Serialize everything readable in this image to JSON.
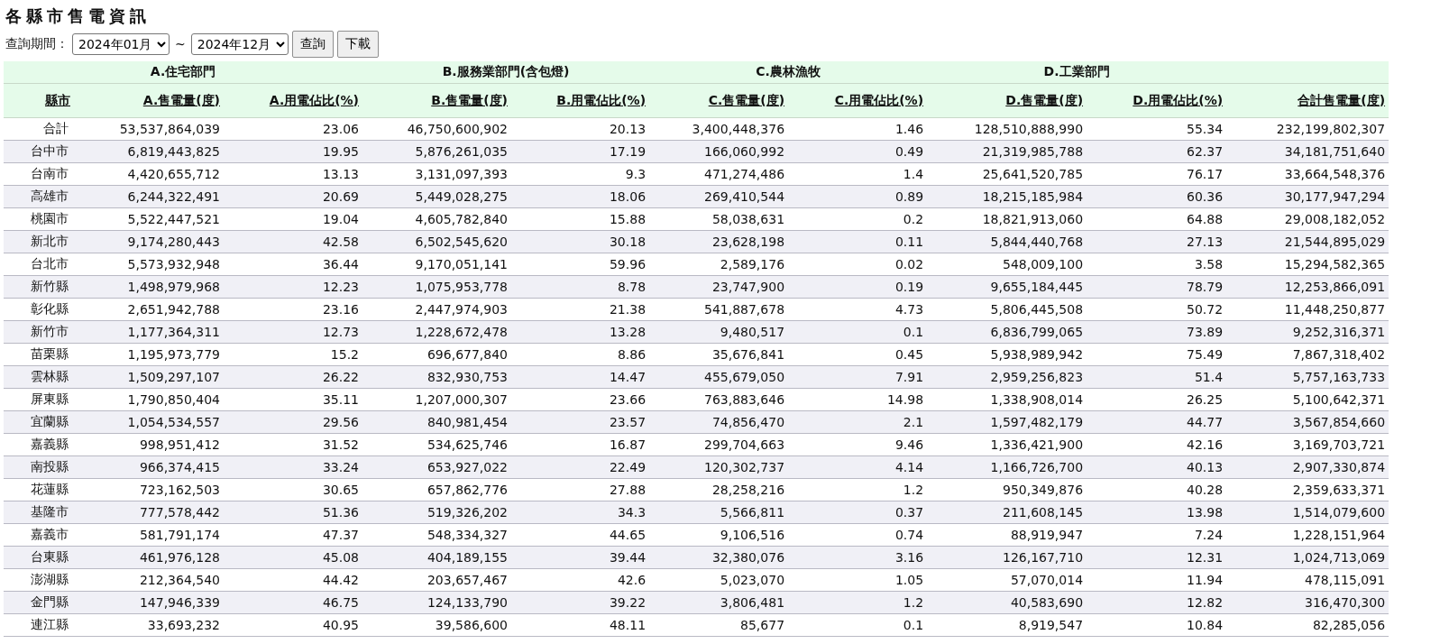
{
  "title": "各縣市售電資訊",
  "query": {
    "label": "查詢期間：",
    "start": "2024年01月",
    "separator": "~",
    "end": "2024年12月",
    "buttons": [
      "查詢",
      "下載"
    ]
  },
  "table": {
    "groups": [
      "A.住宅部門",
      "B.服務業部門(含包燈)",
      "C.農林漁牧",
      "D.工業部門"
    ],
    "columns": [
      "縣市",
      "A.售電量(度)",
      "A.用電佔比(%)",
      "B.售電量(度)",
      "B.用電佔比(%)",
      "C.售電量(度)",
      "C.用電佔比(%)",
      "D.售電量(度)",
      "D.用電佔比(%)",
      "合計售電量(度)"
    ],
    "rows": [
      [
        "合計",
        "53,537,864,039",
        "23.06",
        "46,750,600,902",
        "20.13",
        "3,400,448,376",
        "1.46",
        "128,510,888,990",
        "55.34",
        "232,199,802,307"
      ],
      [
        "台中市",
        "6,819,443,825",
        "19.95",
        "5,876,261,035",
        "17.19",
        "166,060,992",
        "0.49",
        "21,319,985,788",
        "62.37",
        "34,181,751,640"
      ],
      [
        "台南市",
        "4,420,655,712",
        "13.13",
        "3,131,097,393",
        "9.3",
        "471,274,486",
        "1.4",
        "25,641,520,785",
        "76.17",
        "33,664,548,376"
      ],
      [
        "高雄市",
        "6,244,322,491",
        "20.69",
        "5,449,028,275",
        "18.06",
        "269,410,544",
        "0.89",
        "18,215,185,984",
        "60.36",
        "30,177,947,294"
      ],
      [
        "桃園市",
        "5,522,447,521",
        "19.04",
        "4,605,782,840",
        "15.88",
        "58,038,631",
        "0.2",
        "18,821,913,060",
        "64.88",
        "29,008,182,052"
      ],
      [
        "新北市",
        "9,174,280,443",
        "42.58",
        "6,502,545,620",
        "30.18",
        "23,628,198",
        "0.11",
        "5,844,440,768",
        "27.13",
        "21,544,895,029"
      ],
      [
        "台北市",
        "5,573,932,948",
        "36.44",
        "9,170,051,141",
        "59.96",
        "2,589,176",
        "0.02",
        "548,009,100",
        "3.58",
        "15,294,582,365"
      ],
      [
        "新竹縣",
        "1,498,979,968",
        "12.23",
        "1,075,953,778",
        "8.78",
        "23,747,900",
        "0.19",
        "9,655,184,445",
        "78.79",
        "12,253,866,091"
      ],
      [
        "彰化縣",
        "2,651,942,788",
        "23.16",
        "2,447,974,903",
        "21.38",
        "541,887,678",
        "4.73",
        "5,806,445,508",
        "50.72",
        "11,448,250,877"
      ],
      [
        "新竹市",
        "1,177,364,311",
        "12.73",
        "1,228,672,478",
        "13.28",
        "9,480,517",
        "0.1",
        "6,836,799,065",
        "73.89",
        "9,252,316,371"
      ],
      [
        "苗栗縣",
        "1,195,973,779",
        "15.2",
        "696,677,840",
        "8.86",
        "35,676,841",
        "0.45",
        "5,938,989,942",
        "75.49",
        "7,867,318,402"
      ],
      [
        "雲林縣",
        "1,509,297,107",
        "26.22",
        "832,930,753",
        "14.47",
        "455,679,050",
        "7.91",
        "2,959,256,823",
        "51.4",
        "5,757,163,733"
      ],
      [
        "屏東縣",
        "1,790,850,404",
        "35.11",
        "1,207,000,307",
        "23.66",
        "763,883,646",
        "14.98",
        "1,338,908,014",
        "26.25",
        "5,100,642,371"
      ],
      [
        "宜蘭縣",
        "1,054,534,557",
        "29.56",
        "840,981,454",
        "23.57",
        "74,856,470",
        "2.1",
        "1,597,482,179",
        "44.77",
        "3,567,854,660"
      ],
      [
        "嘉義縣",
        "998,951,412",
        "31.52",
        "534,625,746",
        "16.87",
        "299,704,663",
        "9.46",
        "1,336,421,900",
        "42.16",
        "3,169,703,721"
      ],
      [
        "南投縣",
        "966,374,415",
        "33.24",
        "653,927,022",
        "22.49",
        "120,302,737",
        "4.14",
        "1,166,726,700",
        "40.13",
        "2,907,330,874"
      ],
      [
        "花蓮縣",
        "723,162,503",
        "30.65",
        "657,862,776",
        "27.88",
        "28,258,216",
        "1.2",
        "950,349,876",
        "40.28",
        "2,359,633,371"
      ],
      [
        "基隆市",
        "777,578,442",
        "51.36",
        "519,326,202",
        "34.3",
        "5,566,811",
        "0.37",
        "211,608,145",
        "13.98",
        "1,514,079,600"
      ],
      [
        "嘉義市",
        "581,791,174",
        "47.37",
        "548,334,327",
        "44.65",
        "9,106,516",
        "0.74",
        "88,919,947",
        "7.24",
        "1,228,151,964"
      ],
      [
        "台東縣",
        "461,976,128",
        "45.08",
        "404,189,155",
        "39.44",
        "32,380,076",
        "3.16",
        "126,167,710",
        "12.31",
        "1,024,713,069"
      ],
      [
        "澎湖縣",
        "212,364,540",
        "44.42",
        "203,657,467",
        "42.6",
        "5,023,070",
        "1.05",
        "57,070,014",
        "11.94",
        "478,115,091"
      ],
      [
        "金門縣",
        "147,946,339",
        "46.75",
        "124,133,790",
        "39.22",
        "3,806,481",
        "1.2",
        "40,583,690",
        "12.82",
        "316,470,300"
      ],
      [
        "連江縣",
        "33,693,232",
        "40.95",
        "39,586,600",
        "48.11",
        "85,677",
        "0.1",
        "8,919,547",
        "10.84",
        "82,285,056"
      ]
    ]
  }
}
